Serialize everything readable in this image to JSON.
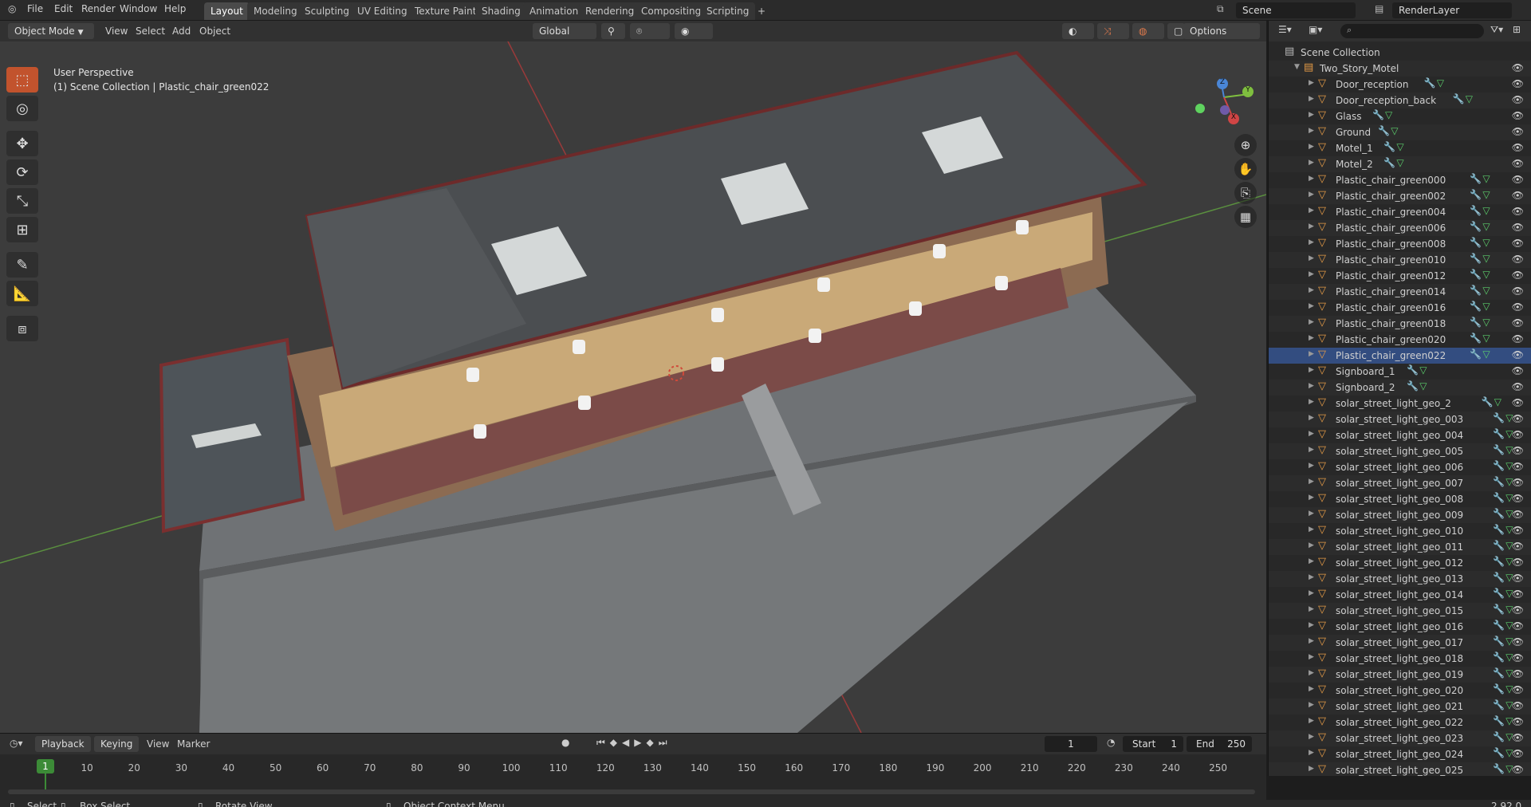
{
  "menu": {
    "file": "File",
    "edit": "Edit",
    "render": "Render",
    "window": "Window",
    "help": "Help"
  },
  "workspaces": [
    "Layout",
    "Modeling",
    "Sculpting",
    "UV Editing",
    "Texture Paint",
    "Shading",
    "Animation",
    "Rendering",
    "Compositing",
    "Scripting"
  ],
  "active_workspace": "Layout",
  "add_workspace": "+",
  "scene": "Scene",
  "render_layer": "RenderLayer",
  "viewport": {
    "mode": "Object Mode",
    "menus": {
      "view": "View",
      "select": "Select",
      "add": "Add",
      "object": "Object"
    },
    "transform_orientation": "Global",
    "options": "Options",
    "perspective": "User Perspective",
    "collection_info": "(1) Scene Collection | Plastic_chair_green022",
    "gizmo": {
      "x": "X",
      "y": "Y",
      "z": "Z"
    }
  },
  "outliner": {
    "root": "Scene Collection",
    "collection": "Two_Story_Motel",
    "selected": "Plastic_chair_green022",
    "items": [
      "Door_reception",
      "Door_reception_back",
      "Glass",
      "Ground",
      "Motel_1",
      "Motel_2",
      "Plastic_chair_green000",
      "Plastic_chair_green002",
      "Plastic_chair_green004",
      "Plastic_chair_green006",
      "Plastic_chair_green008",
      "Plastic_chair_green010",
      "Plastic_chair_green012",
      "Plastic_chair_green014",
      "Plastic_chair_green016",
      "Plastic_chair_green018",
      "Plastic_chair_green020",
      "Plastic_chair_green022",
      "Signboard_1",
      "Signboard_2",
      "solar_street_light_geo_2",
      "solar_street_light_geo_003",
      "solar_street_light_geo_004",
      "solar_street_light_geo_005",
      "solar_street_light_geo_006",
      "solar_street_light_geo_007",
      "solar_street_light_geo_008",
      "solar_street_light_geo_009",
      "solar_street_light_geo_010",
      "solar_street_light_geo_011",
      "solar_street_light_geo_012",
      "solar_street_light_geo_013",
      "solar_street_light_geo_014",
      "solar_street_light_geo_015",
      "solar_street_light_geo_016",
      "solar_street_light_geo_017",
      "solar_street_light_geo_018",
      "solar_street_light_geo_019",
      "solar_street_light_geo_020",
      "solar_street_light_geo_021",
      "solar_street_light_geo_022",
      "solar_street_light_geo_023",
      "solar_street_light_geo_024",
      "solar_street_light_geo_025"
    ]
  },
  "timeline": {
    "menus": {
      "playback": "Playback",
      "keying": "Keying",
      "view": "View",
      "marker": "Marker"
    },
    "current_frame": "1",
    "start_label": "Start",
    "start": "1",
    "end_label": "End",
    "end": "250",
    "ticks": [
      "10",
      "20",
      "30",
      "40",
      "50",
      "60",
      "70",
      "80",
      "90",
      "100",
      "110",
      "120",
      "130",
      "140",
      "150",
      "160",
      "170",
      "180",
      "190",
      "200",
      "210",
      "220",
      "230",
      "240",
      "250"
    ],
    "playhead_label": "1"
  },
  "statusbar": {
    "select": "Select",
    "box_select": "Box Select",
    "rotate_view": "Rotate View",
    "context_menu": "Object Context Menu",
    "version": "2.92.0"
  },
  "colors": {
    "accent": "#c2532d",
    "selection": "#334d80",
    "frame": "#3c8b37"
  }
}
